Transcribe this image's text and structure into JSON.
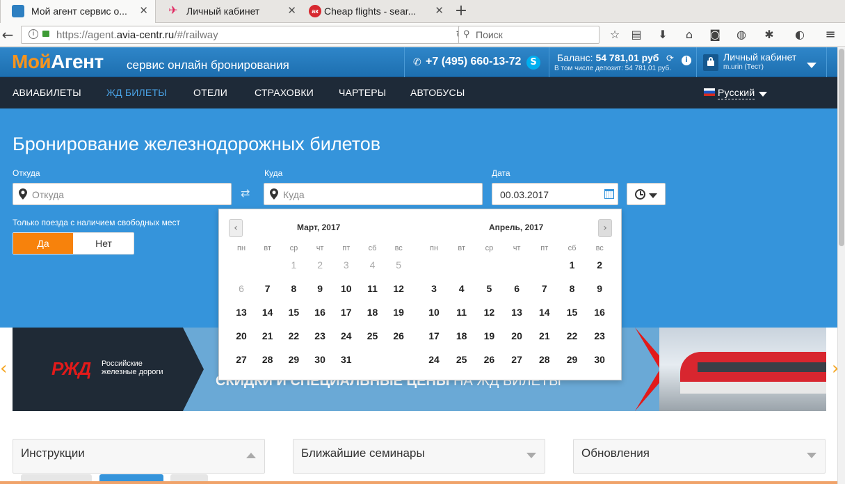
{
  "browser": {
    "tabs": [
      {
        "title": "Мой агент сервис о...",
        "active": true
      },
      {
        "title": "Личный кабинет",
        "active": false
      },
      {
        "title": "Cheap flights - sear...",
        "active": false
      }
    ],
    "url_prefix": "https://agent.",
    "url_domain": "avia-centr.ru",
    "url_path": "/#/railway",
    "search_placeholder": "Поиск"
  },
  "header": {
    "logo_part1": "Мой",
    "logo_part2": "Агент",
    "tagline": "сервис онлайн бронирования",
    "phone": "+7 (495) 660-13-72",
    "balance_label": "Баланс:",
    "balance_value": "54 781,01 руб",
    "deposit_text": "В том числе депозит: 54 781,01 руб.",
    "account_label": "Личный кабинет",
    "account_user": "m.urin (Тест)"
  },
  "menu": {
    "items": [
      "АВИАБИЛЕТЫ",
      "ЖД БИЛЕТЫ",
      "ОТЕЛИ",
      "СТРАХОВКИ",
      "ЧАРТЕРЫ",
      "АВТОБУСЫ"
    ],
    "language": "Русский"
  },
  "search": {
    "title": "Бронирование железнодорожных билетов",
    "from_label": "Откуда",
    "from_placeholder": "Откуда",
    "to_label": "Куда",
    "to_placeholder": "Куда",
    "date_label": "Дата",
    "date_value": "00.03.2017",
    "free_seats_label": "Только поезда с наличием свободных мест",
    "yes": "Да",
    "no": "Нет"
  },
  "datepicker": {
    "weekdays": [
      "пн",
      "вт",
      "ср",
      "чт",
      "пт",
      "сб",
      "вс"
    ],
    "months": [
      {
        "title": "Март, 2017",
        "lead": 2,
        "disabled": [
          1,
          2,
          3,
          4,
          5,
          6
        ],
        "days": 31
      },
      {
        "title": "Апрель, 2017",
        "lead": 5,
        "disabled": [],
        "days": 30
      }
    ]
  },
  "banner": {
    "brand": "Российские железные дороги",
    "text_bold": "СКИДКИ И СПЕЦИАЛЬНЫЕ ЦЕНЫ",
    "text_rest": " НА ЖД БИЛЕТЫ"
  },
  "widgets": [
    {
      "title": "Инструкции"
    },
    {
      "title": "Ближайшие семинары"
    },
    {
      "title": "Обновления"
    }
  ],
  "colors": {
    "accent_blue": "#3594db",
    "menu_dark": "#1e2a38",
    "orange": "#f7820c",
    "rzd_red": "#e21a1a"
  }
}
